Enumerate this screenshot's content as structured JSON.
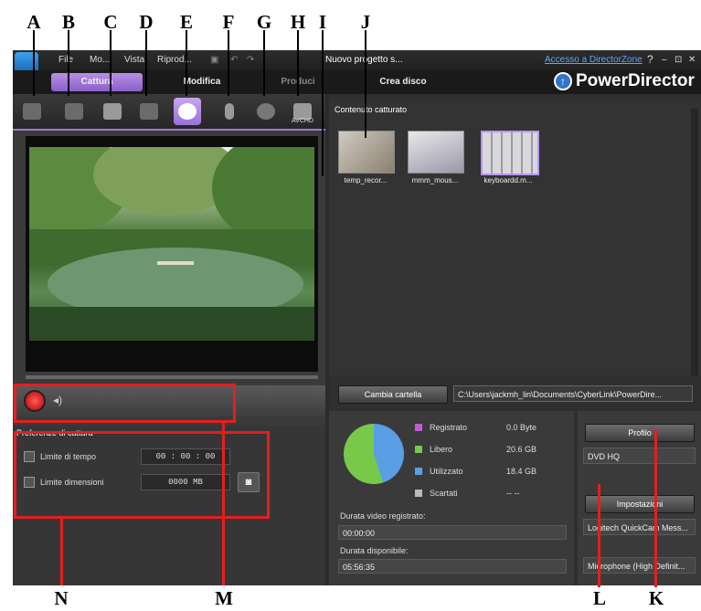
{
  "callouts": [
    "A",
    "B",
    "C",
    "D",
    "E",
    "F",
    "G",
    "H",
    "I",
    "J",
    "K",
    "L",
    "M",
    "N"
  ],
  "colors": {
    "accent": "#9b7ad6",
    "highlight": "#e41f1f",
    "free": "#78c84a",
    "used": "#5a9ee6",
    "recorded": "#c05cd0",
    "discarded": "#bbbbbb"
  },
  "menu": {
    "items": [
      "File",
      "Mo...",
      "Vista",
      "Riprod..."
    ],
    "project": "Nuovo progetto s...",
    "login": "Accesso a DirectorZone",
    "help": "?",
    "min": "–",
    "restore": "⊡",
    "close": "✕"
  },
  "tabs": {
    "capture": "Cattura",
    "edit": "Modifica",
    "produce": "Produci",
    "disc": "Crea disco"
  },
  "brand": "PowerDirector",
  "toolbar": {
    "icons": [
      "dv-camcorder-icon",
      "hdv-camcorder-icon",
      "tv-capture-icon",
      "digital-tv-icon",
      "webcam-icon",
      "microphone-icon",
      "cd-icon",
      "avchd-camcorder-icon"
    ],
    "avchd_label": "AVCHD"
  },
  "preferences": {
    "title": "Preferenze di cattura",
    "time_limit": "Limite di tempo",
    "time_value": "00 : 00 : 00",
    "size_limit": "Limite dimensioni",
    "size_value": "0000  MB"
  },
  "content": {
    "title": "Contenuto catturato",
    "items": [
      "temp_recor...",
      "mmm_mous...",
      "keyboardd.m..."
    ]
  },
  "folder": {
    "button": "Cambia cartella",
    "path": "C:\\Users\\jackmh_lin\\Documents\\CyberLink\\PowerDire..."
  },
  "disk": {
    "recorded_label": "Registrato",
    "recorded_value": "0.0  Byte",
    "free_label": "Libero",
    "free_value": "20.6  GB",
    "used_label": "Utilizzato",
    "used_value": "18.4  GB",
    "discarded_label": "Scartati",
    "discarded_value": "-- --"
  },
  "durations": {
    "recorded_label": "Durata video registrato:",
    "recorded_value": "00:00:00",
    "available_label": "Durata disponibile:",
    "available_value": "05:56:35"
  },
  "profile": {
    "button": "Profilo",
    "value": "DVD HQ"
  },
  "settings": {
    "button": "Impostazioni",
    "video_device": "Logitech QuickCam Mess...",
    "audio_device": "Microphone (High Definit..."
  }
}
